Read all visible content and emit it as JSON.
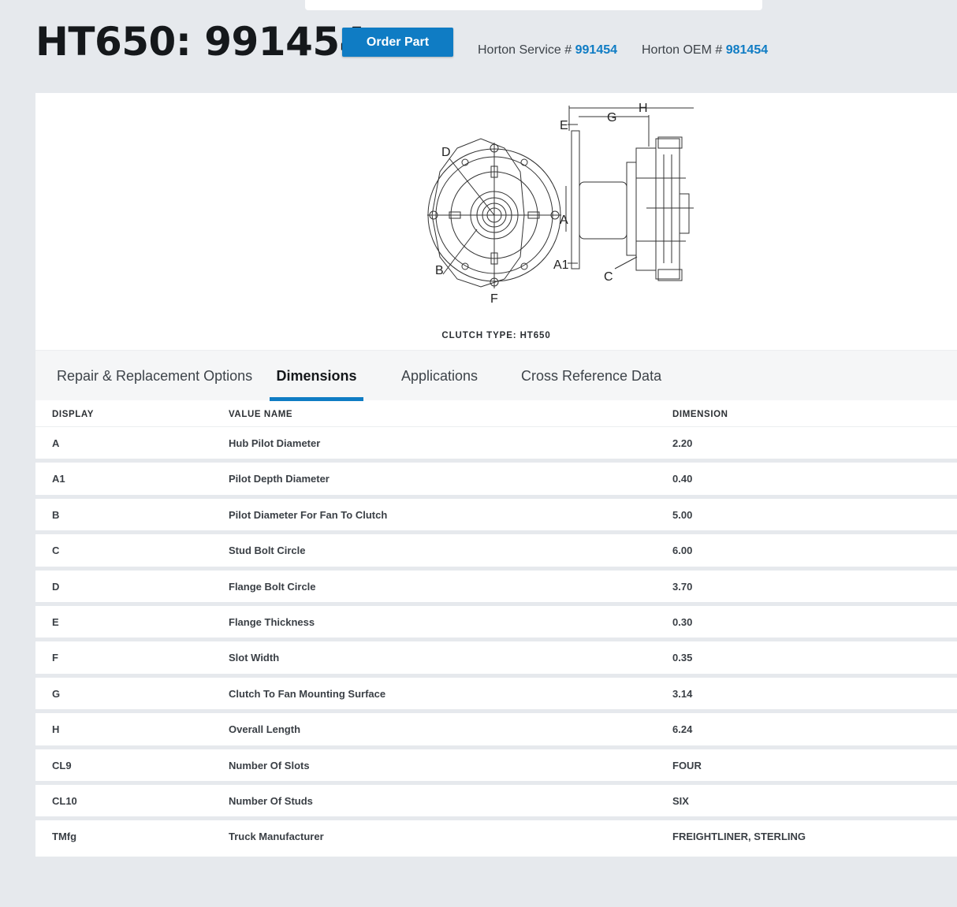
{
  "header": {
    "title": "HT650: 991454",
    "order_button": "Order Part",
    "service_label": "Horton Service #",
    "service_number": "991454",
    "oem_label": "Horton OEM #",
    "oem_number": "981454"
  },
  "diagram": {
    "labels": [
      "A",
      "A1",
      "B",
      "C",
      "D",
      "E",
      "F",
      "G",
      "H"
    ],
    "caption": "CLUTCH TYPE: HT650"
  },
  "tabs": [
    {
      "label": "Repair & Replacement Options",
      "active": false
    },
    {
      "label": "Dimensions",
      "active": true
    },
    {
      "label": "Applications",
      "active": false
    },
    {
      "label": "Cross Reference Data",
      "active": false
    }
  ],
  "table": {
    "headers": [
      "DISPLAY",
      "VALUE NAME",
      "DIMENSION"
    ],
    "rows": [
      {
        "display": "A",
        "name": "Hub Pilot Diameter",
        "value": "2.20"
      },
      {
        "display": "A1",
        "name": "Pilot Depth Diameter",
        "value": "0.40"
      },
      {
        "display": "B",
        "name": "Pilot Diameter For Fan To Clutch",
        "value": "5.00"
      },
      {
        "display": "C",
        "name": "Stud Bolt Circle",
        "value": "6.00"
      },
      {
        "display": "D",
        "name": "Flange Bolt Circle",
        "value": "3.70"
      },
      {
        "display": "E",
        "name": "Flange Thickness",
        "value": "0.30"
      },
      {
        "display": "F",
        "name": "Slot Width",
        "value": "0.35"
      },
      {
        "display": "G",
        "name": "Clutch To Fan Mounting Surface",
        "value": "3.14"
      },
      {
        "display": "H",
        "name": "Overall Length",
        "value": "6.24"
      },
      {
        "display": "CL9",
        "name": "Number Of Slots",
        "value": "FOUR"
      },
      {
        "display": "CL10",
        "name": "Number Of Studs",
        "value": "SIX"
      },
      {
        "display": "TMfg",
        "name": "Truck Manufacturer",
        "value": "FREIGHTLINER, STERLING"
      }
    ]
  },
  "colors": {
    "accent": "#0f7cc4",
    "background": "#e6e9ed",
    "card": "#ffffff"
  }
}
